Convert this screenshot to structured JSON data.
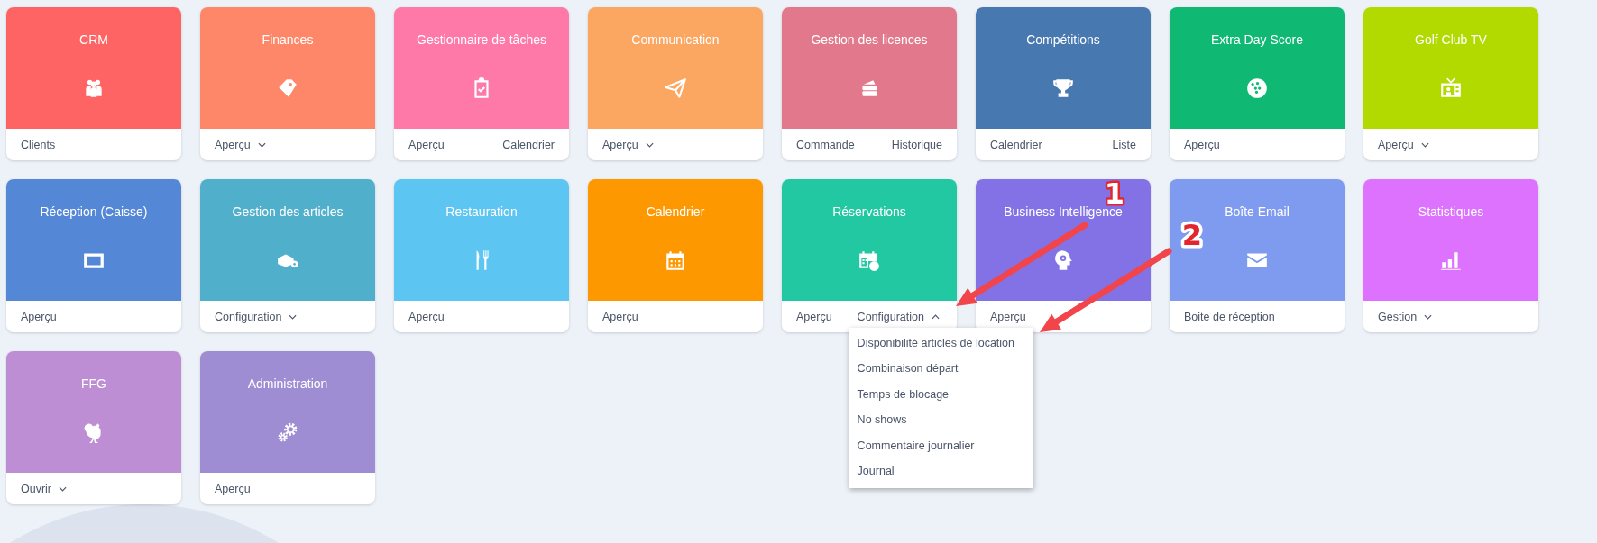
{
  "tiles": [
    {
      "title": "CRM",
      "color": "#fe6464",
      "links": [
        {
          "label": "Clients",
          "kind": "link"
        }
      ]
    },
    {
      "title": "Finances",
      "color": "#fe8769",
      "links": [
        {
          "label": "Aperçu",
          "kind": "dropdown",
          "expanded": false
        }
      ]
    },
    {
      "title": "Gestionnaire de tâches",
      "color": "#fe79a7",
      "links": [
        {
          "label": "Aperçu",
          "kind": "link"
        },
        {
          "label": "Calendrier",
          "kind": "link"
        }
      ]
    },
    {
      "title": "Communication",
      "color": "#fba661",
      "links": [
        {
          "label": "Aperçu",
          "kind": "dropdown",
          "expanded": false
        }
      ]
    },
    {
      "title": "Gestion des licences",
      "color": "#e2788c",
      "links": [
        {
          "label": "Commande",
          "kind": "link"
        },
        {
          "label": "Historique",
          "kind": "link"
        }
      ]
    },
    {
      "title": "Compétitions",
      "color": "#4878b0",
      "links": [
        {
          "label": "Calendrier",
          "kind": "link"
        },
        {
          "label": "Liste",
          "kind": "link"
        }
      ]
    },
    {
      "title": "Extra Day Score",
      "color": "#10b973",
      "links": [
        {
          "label": "Aperçu",
          "kind": "link"
        }
      ]
    },
    {
      "title": "Golf Club TV",
      "color": "#b2d900",
      "links": [
        {
          "label": "Aperçu",
          "kind": "dropdown",
          "expanded": false
        }
      ]
    },
    {
      "title": "Réception (Caisse)",
      "color": "#5487d5",
      "links": [
        {
          "label": "Aperçu",
          "kind": "link"
        }
      ]
    },
    {
      "title": "Gestion des articles",
      "color": "#50afca",
      "links": [
        {
          "label": "Configuration",
          "kind": "dropdown",
          "expanded": false
        }
      ]
    },
    {
      "title": "Restauration",
      "color": "#5cc5f2",
      "links": [
        {
          "label": "Aperçu",
          "kind": "link"
        }
      ]
    },
    {
      "title": "Calendrier",
      "color": "#fe9800",
      "links": [
        {
          "label": "Aperçu",
          "kind": "link"
        }
      ]
    },
    {
      "title": "Réservations",
      "color": "#22c8a2",
      "links": [
        {
          "label": "Aperçu",
          "kind": "link"
        },
        {
          "label": "Configuration",
          "kind": "dropdown",
          "expanded": true,
          "menu": [
            "Disponibilité articles de location",
            "Combinaison départ",
            "Temps de blocage",
            "No shows",
            "Commentaire journalier",
            "Journal"
          ]
        }
      ]
    },
    {
      "title": "Business Intelligence",
      "color": "#8372e6",
      "links": [
        {
          "label": "Aperçu",
          "kind": "link"
        }
      ]
    },
    {
      "title": "Boîte Email",
      "color": "#7f9bef",
      "links": [
        {
          "label": "Boite de réception",
          "kind": "link"
        }
      ]
    },
    {
      "title": "Statistiques",
      "color": "#dc72fe",
      "links": [
        {
          "label": "Gestion",
          "kind": "dropdown",
          "expanded": false
        }
      ]
    },
    {
      "title": "FFG",
      "color": "#bd8ed3",
      "links": [
        {
          "label": "Ouvrir",
          "kind": "dropdown",
          "expanded": false
        }
      ]
    },
    {
      "title": "Administration",
      "color": "#9e8dd3",
      "links": [
        {
          "label": "Aperçu",
          "kind": "link"
        }
      ]
    }
  ],
  "annotations": [
    {
      "label": "1"
    },
    {
      "label": "2"
    }
  ]
}
